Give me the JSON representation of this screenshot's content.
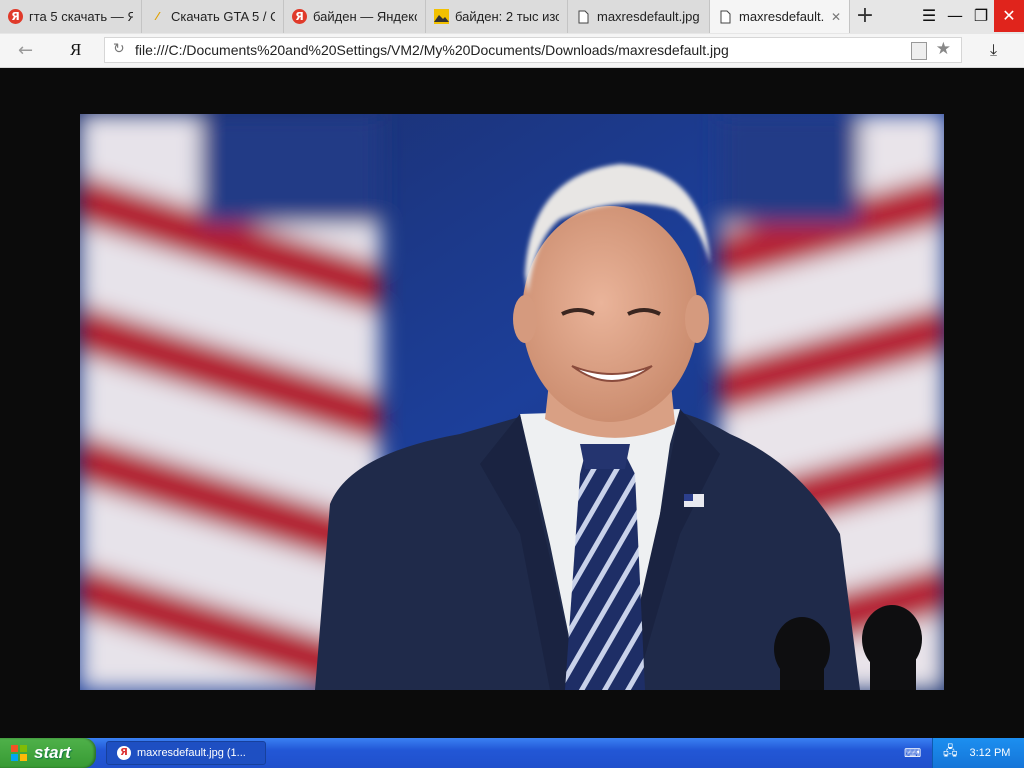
{
  "browser": {
    "tabs": [
      {
        "title": "гта 5 скачать — Я",
        "icon": "yandex-icon",
        "active": false
      },
      {
        "title": "Скачать GTA 5 / С",
        "icon": "site-icon",
        "active": false
      },
      {
        "title": "байден — Яндекс",
        "icon": "yandex-icon",
        "active": false
      },
      {
        "title": "байден: 2 тыс изо",
        "icon": "image-search-icon",
        "active": false
      },
      {
        "title": "maxresdefault.jpg",
        "icon": "page-icon",
        "active": false
      },
      {
        "title": "maxresdefault.",
        "icon": "page-icon",
        "active": true
      }
    ],
    "new_tab_symbol": "+",
    "menu_symbol": "☰",
    "minimize_symbol": "—",
    "restore_symbol": "❐",
    "close_symbol": "✕",
    "tab_close_symbol": "✕",
    "back_symbol": "←",
    "yandex_logo": "Я",
    "reload_symbol": "↻",
    "url": "file:///C:/Documents%20and%20Settings/VM2/My%20Documents/Downloads/maxresdefault.jpg",
    "star_symbol": "★",
    "download_symbol": "⤓"
  },
  "taskbar": {
    "start_label": "start",
    "task_item": "maxresdefault.jpg (1...",
    "task_icon_letter": "Я",
    "clock": "3:12 PM"
  },
  "colors": {
    "start_green": "#3aa335",
    "taskbar_blue": "#2457d4",
    "close_red": "#e0241c"
  }
}
